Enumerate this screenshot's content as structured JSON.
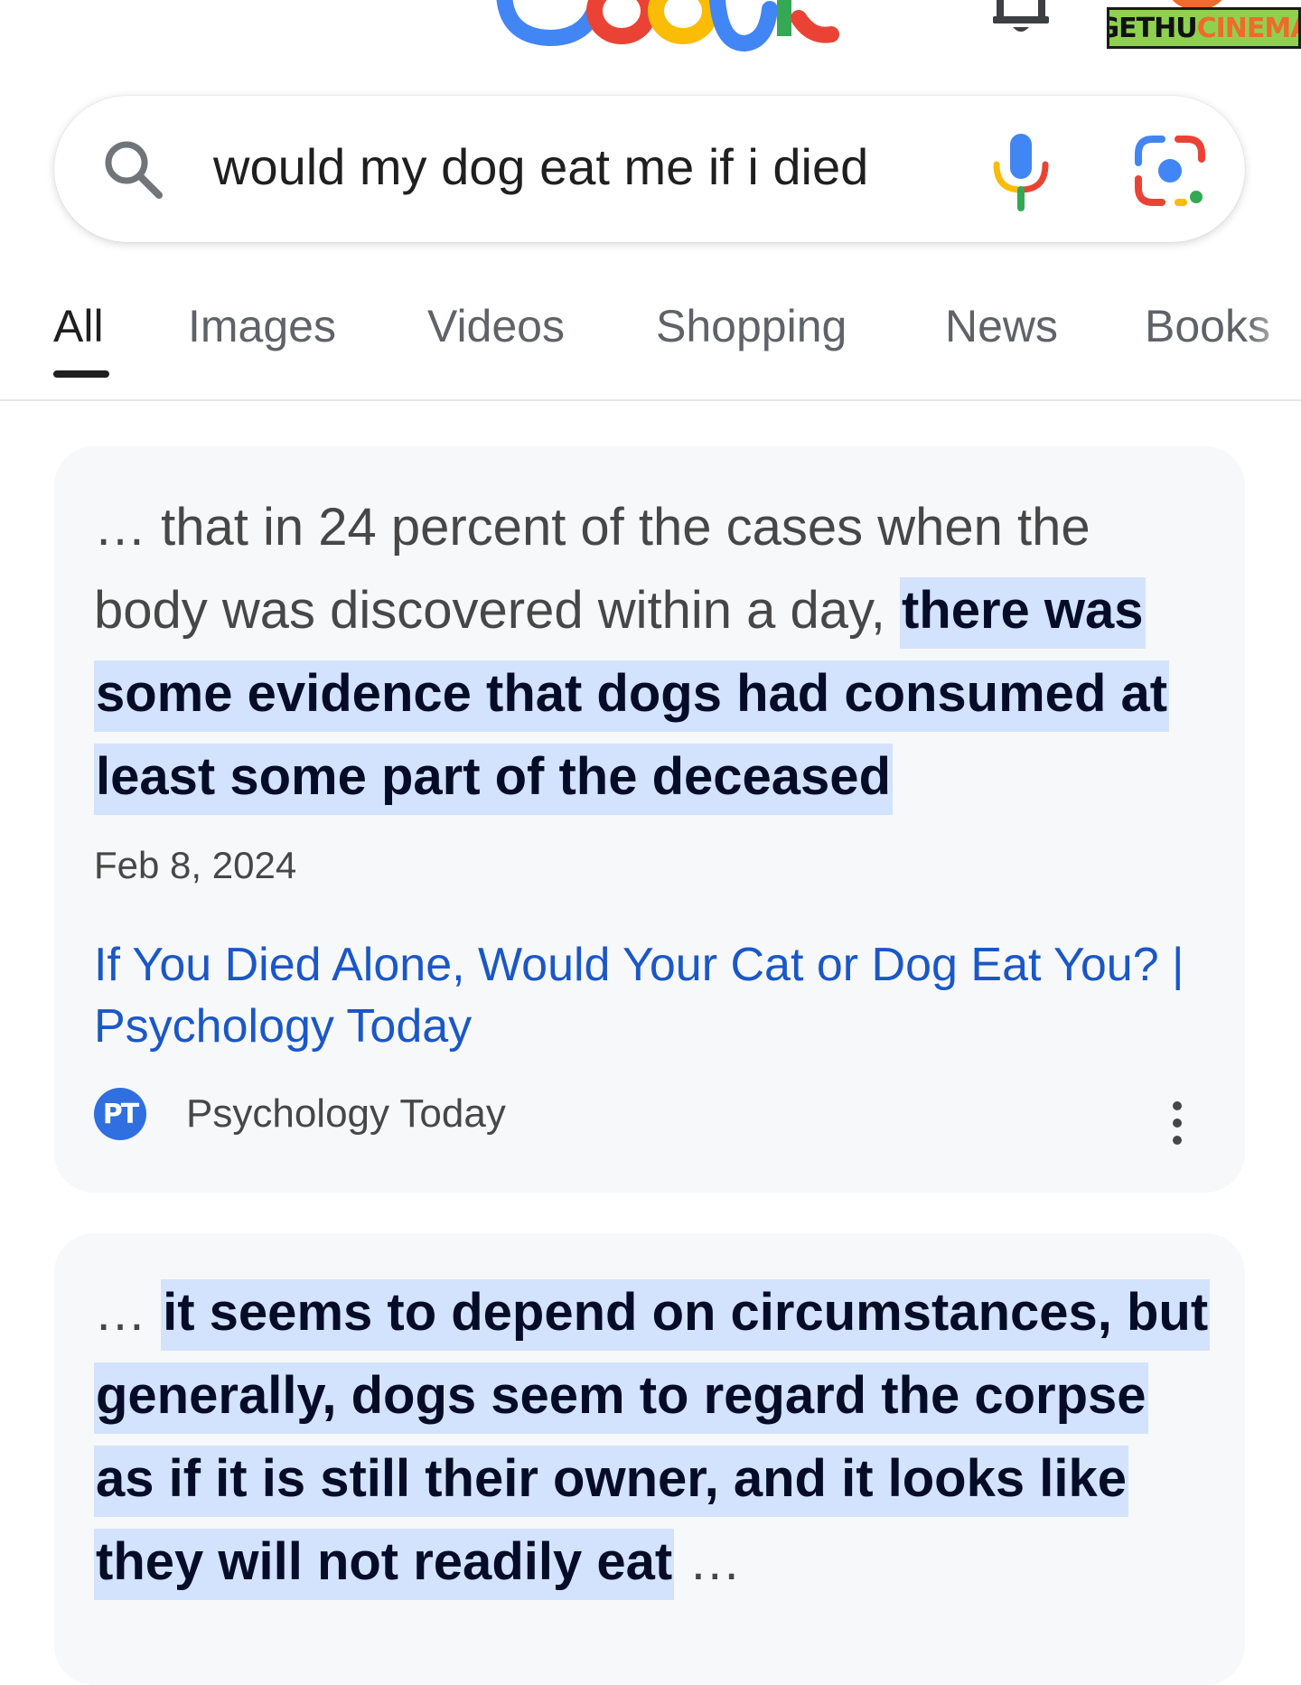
{
  "header": {
    "watermark": {
      "part1": "GETHU",
      "part2": "CINEMA"
    }
  },
  "search": {
    "query": "would my dog eat me if i died"
  },
  "tabs": [
    {
      "label": "All",
      "active": true
    },
    {
      "label": "Images",
      "active": false
    },
    {
      "label": "Videos",
      "active": false
    },
    {
      "label": "Shopping",
      "active": false
    },
    {
      "label": "News",
      "active": false
    },
    {
      "label": "Books",
      "active": false
    }
  ],
  "results": [
    {
      "snippet_prefix": "… that in 24 percent of the cases when the body was discovered within a day, ",
      "snippet_highlight": "there was some evidence that dogs had consumed at least some part of the deceased",
      "date": "Feb 8, 2024",
      "title": "If You Died Alone, Would Your Cat or Dog Eat You? | Psychology Today",
      "favicon_text": "PT",
      "source": "Psychology Today"
    },
    {
      "snippet_prefix": "… ",
      "snippet_highlight": "it seems to depend on circumstances, but generally, dogs seem to regard the corpse as if it is still their owner, and it looks like they will not readily eat",
      "snippet_suffix": " …"
    }
  ],
  "colors": {
    "highlight_bg": "#d3e3fd",
    "link": "#1a57c8",
    "card_bg": "#f7f8f9",
    "favicon_bg": "#2f6fe0"
  },
  "icons": [
    "google-logo",
    "bell-icon",
    "search-icon",
    "microphone-icon",
    "google-lens-icon",
    "more-vert-icon"
  ]
}
